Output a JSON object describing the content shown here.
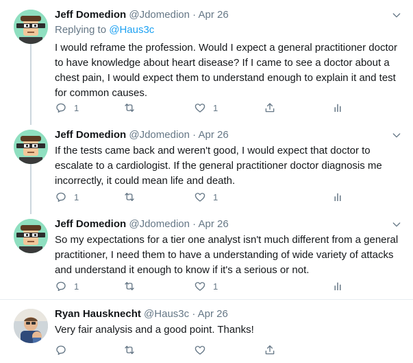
{
  "tweets": [
    {
      "name": "Jeff Domedion",
      "handle": "@Jdomedion",
      "sep": "·",
      "date": "Apr 26",
      "replying_prefix": "Replying to ",
      "replying_handle": "@Haus3c",
      "text": "I would reframe the profession. Would I expect a general practitioner doctor to have knowledge about heart disease? If I came to see a doctor about a chest pain, I would expect them to understand enough to explain it and test for common causes.",
      "reply_count": "1",
      "retweet_count": "",
      "like_count": "1"
    },
    {
      "name": "Jeff Domedion",
      "handle": "@Jdomedion",
      "sep": "·",
      "date": "Apr 26",
      "text": "If the tests came back and weren't good, I would expect that doctor to escalate to a cardiologist. If the general practitioner doctor diagnosis me incorrectly, it could mean life and death.",
      "reply_count": "1",
      "retweet_count": "",
      "like_count": "1"
    },
    {
      "name": "Jeff Domedion",
      "handle": "@Jdomedion",
      "sep": "·",
      "date": "Apr 26",
      "text": "So my expectations for a tier one analyst isn't much different from a general practitioner, I need them to have a understanding of wide variety of attacks and understand it enough to know if it's a serious or not.",
      "reply_count": "1",
      "retweet_count": "",
      "like_count": "1"
    },
    {
      "name": "Ryan Hausknecht",
      "handle": "@Haus3c",
      "sep": "·",
      "date": "Apr 26",
      "text": "Very fair analysis and a good point. Thanks!",
      "reply_count": "",
      "retweet_count": "",
      "like_count": ""
    }
  ],
  "icons": {
    "reply": "reply-icon",
    "retweet": "retweet-icon",
    "like": "heart-icon",
    "share": "share-icon",
    "analytics": "analytics-icon",
    "more": "chevron-down-icon"
  },
  "colors": {
    "accent": "#1da1f2",
    "muted": "#657786",
    "text": "#14171a",
    "thread_line": "#ccd6dd"
  }
}
